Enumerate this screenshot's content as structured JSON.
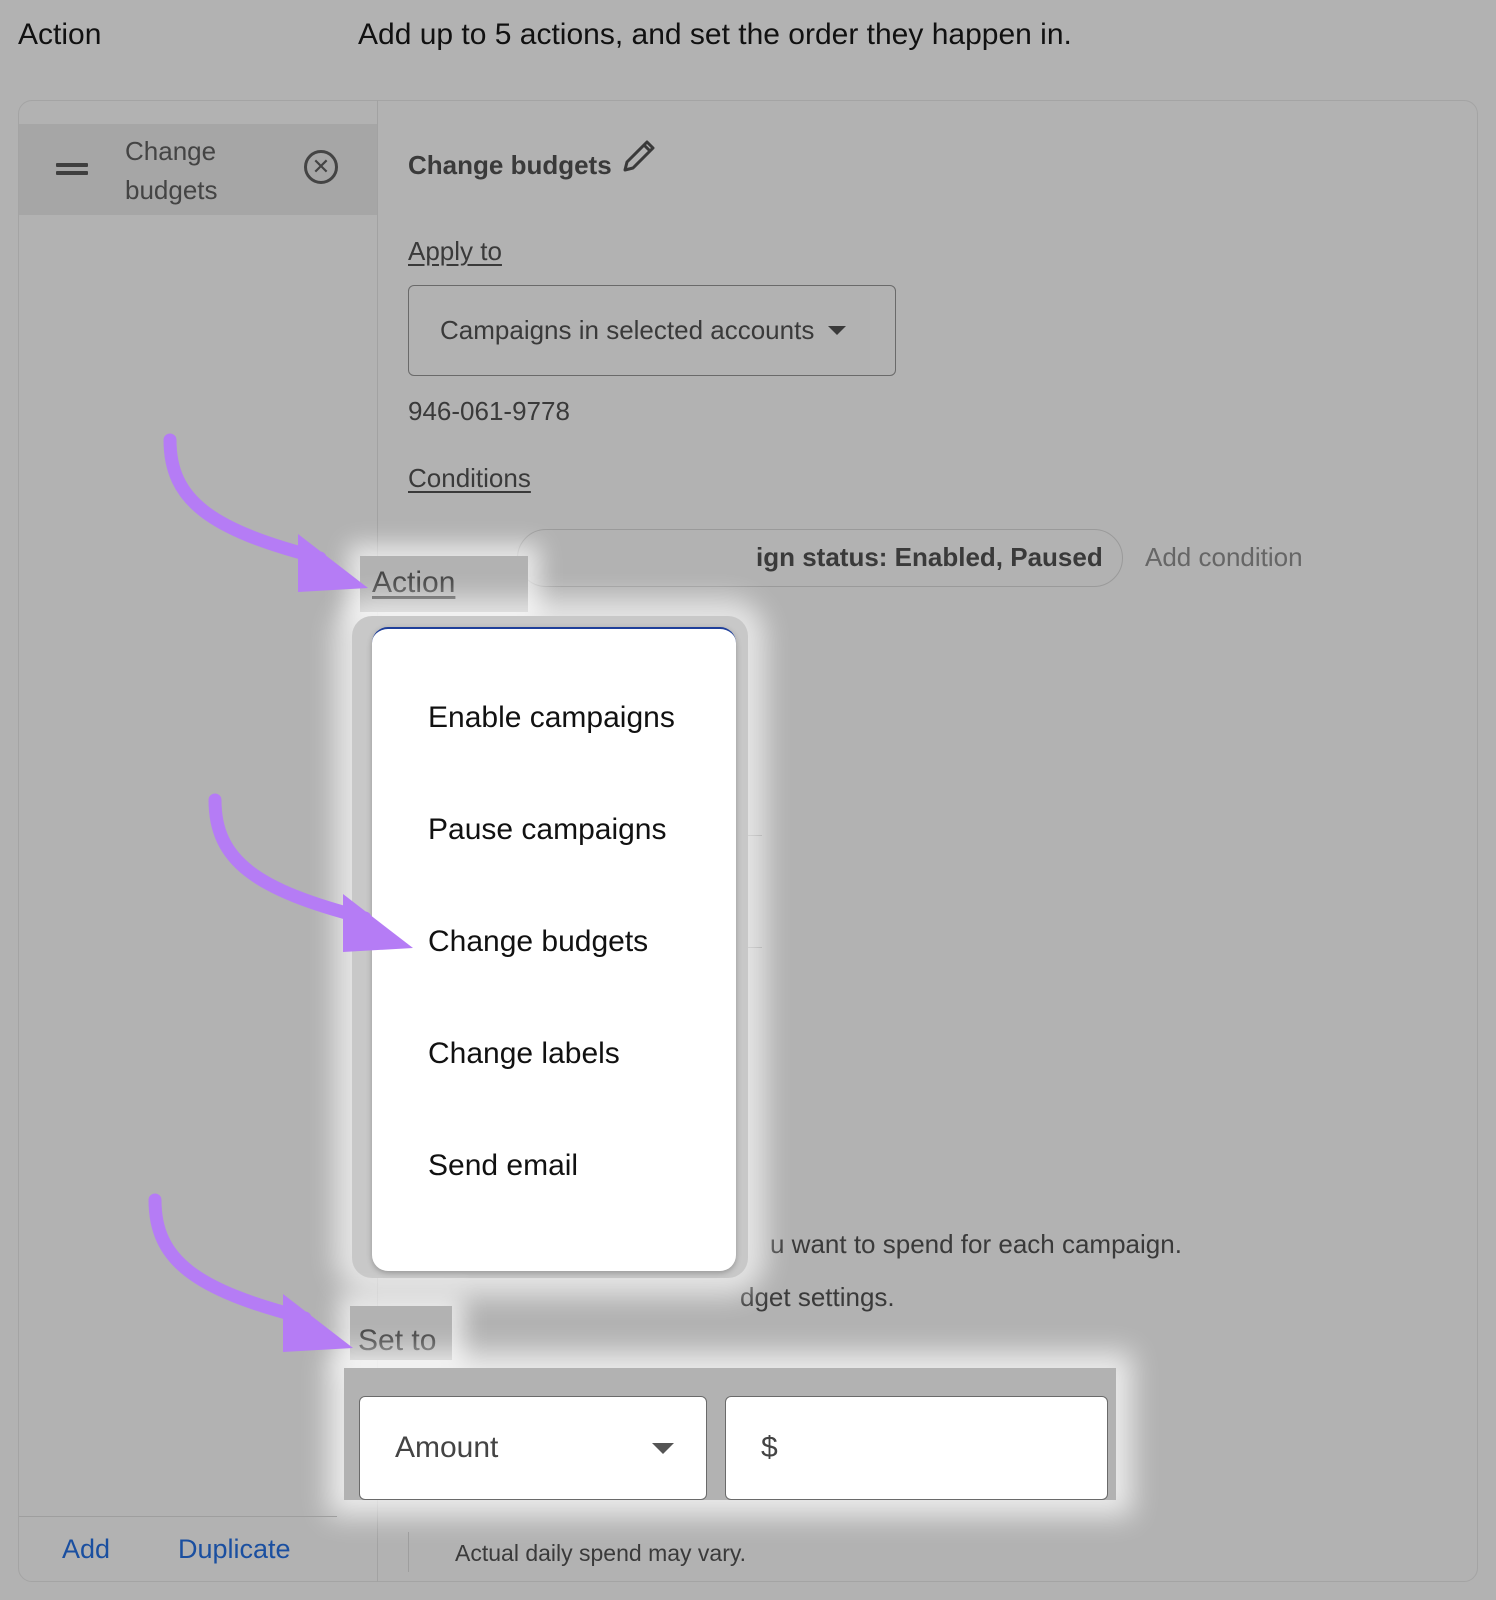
{
  "header": {
    "title": "Action",
    "subtitle": "Add up to 5 actions, and set the order they happen in."
  },
  "sidebar": {
    "items": [
      {
        "label": "Change budgets",
        "icon_left": "drag-handle-icon",
        "icon_right": "remove-circle-icon"
      }
    ],
    "footer": {
      "add_label": "Add",
      "duplicate_label": "Duplicate"
    }
  },
  "main": {
    "title": "Change budgets",
    "title_icon": "pencil-icon",
    "apply_to": {
      "label": "Apply to",
      "selected": "Campaigns in selected accounts",
      "account_id": "946-061-9778"
    },
    "conditions": {
      "label": "Conditions",
      "chip_text": "ign status: Enabled, Paused",
      "add_label": "Add condition"
    },
    "action": {
      "label": "Action",
      "menu_items": [
        "Enable campaigns",
        "Pause campaigns",
        "Change budgets",
        "Change labels",
        "Send email"
      ]
    },
    "description_line1": "u want to spend for each campaign.",
    "description_line2": "dget settings.",
    "set_to": {
      "label": "Set to",
      "type_selected": "Amount",
      "amount_prefix": "$",
      "amount_value": ""
    },
    "note": "Actual daily spend may vary."
  },
  "annotations": {
    "arrow_color": "#b57cf5",
    "targets": [
      "Action",
      "Change budgets",
      "Set to"
    ]
  }
}
